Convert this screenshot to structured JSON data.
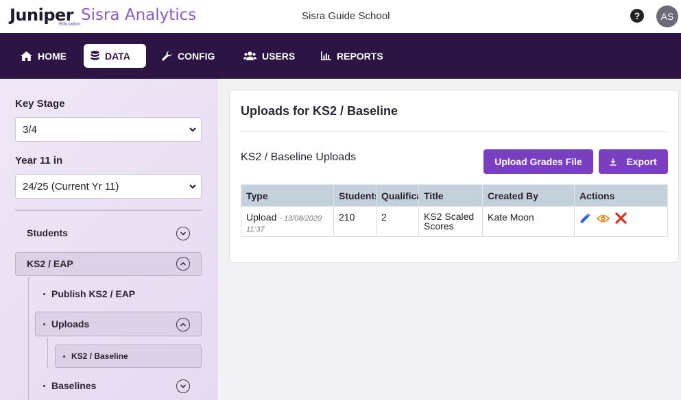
{
  "header": {
    "brand_main": "Juniper",
    "brand_sub": "Education",
    "product": "Sisra Analytics",
    "school": "Sisra Guide School",
    "avatar_initials": "AS"
  },
  "nav": {
    "home": "HOME",
    "data": "DATA",
    "config": "CONFIG",
    "users": "USERS",
    "reports": "REPORTS",
    "active": "DATA"
  },
  "sidebar": {
    "key_stage_label": "Key Stage",
    "key_stage_value": "3/4",
    "year_label": "Year 11 in",
    "year_value": "24/25 (Current Yr 11)",
    "students": "Students",
    "ks2_eap": "KS2 / EAP",
    "publish": "Publish KS2 / EAP",
    "uploads": "Uploads",
    "ks2_baseline": "KS2 / Baseline",
    "baselines": "Baselines"
  },
  "main": {
    "title": "Uploads for KS2 / Baseline",
    "subtitle": "KS2 / Baseline Uploads",
    "upload_btn": "Upload Grades File",
    "export_btn": "Export",
    "columns": {
      "type": "Type",
      "students": "Students",
      "qualifications": "Qualifications",
      "title": "Title",
      "created_by": "Created By",
      "actions": "Actions"
    },
    "rows": [
      {
        "type": "Upload",
        "timestamp": "- 13/08/2020 11:37",
        "students": "210",
        "qualifications": "2",
        "title": "KS2 Scaled Scores",
        "created_by": "Kate Moon"
      }
    ]
  },
  "colors": {
    "nav_bg": "#2c1445",
    "accent_purple": "#7a3ec0",
    "brand_purple": "#8c5cc6",
    "edit_blue": "#2f62d8",
    "view_orange": "#f08c1e",
    "delete_red": "#d33a2c"
  }
}
